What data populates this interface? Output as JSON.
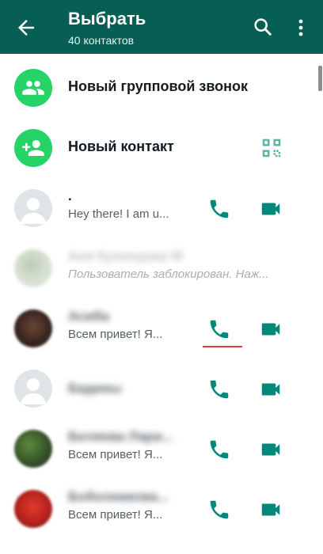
{
  "header": {
    "title": "Выбрать",
    "subtitle": "40 контактов"
  },
  "actions": [
    {
      "label": "Новый групповой звонок"
    },
    {
      "label": "Новый контакт"
    }
  ],
  "contacts": [
    {
      "name": ".",
      "status": "Hey there! I am u..."
    },
    {
      "name": "Аня Кузнецова М",
      "status": "Пользователь заблокирован. Наж..."
    },
    {
      "name": "Асиба",
      "status": "Всем привет! Я..."
    },
    {
      "name": "Бадины",
      "status": ""
    },
    {
      "name": "Беляева Лари...",
      "status": "Всем привет! Я..."
    },
    {
      "name": "Боболникова...",
      "status": "Всем привет! Я..."
    }
  ],
  "colors": {
    "appbar": "#075e54",
    "accent": "#25d366",
    "icon": "#00897b",
    "highlight": "#e53935"
  }
}
